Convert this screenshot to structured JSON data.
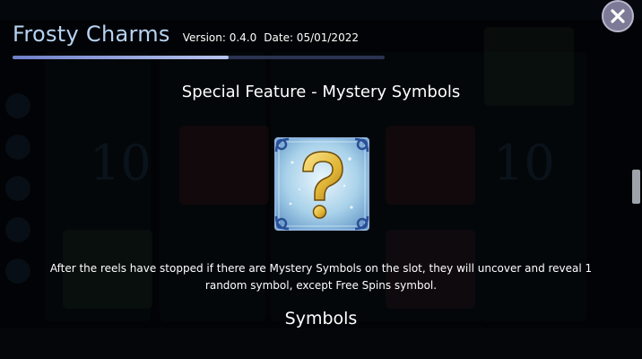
{
  "header": {
    "game_title": "Frosty Charms",
    "version_label": "Version: 0.4.0",
    "date_label": "Date: 05/01/2022"
  },
  "help_progress": 0.58,
  "feature": {
    "title": "Special Feature - Mystery Symbols",
    "symbol_icon": "question-mark-ice-icon",
    "description": "After the reels have stopped if there are Mystery Symbols on the slot, they will uncover and reveal 1 random symbol, except Free Spins symbol."
  },
  "next_section_title": "Symbols",
  "close_icon": "close-x-icon",
  "colors": {
    "title": "#b7d3f2",
    "close_button": "#7d7a98",
    "symbol_gold": "#e9c64a",
    "symbol_ice": "#bfe0f3"
  }
}
